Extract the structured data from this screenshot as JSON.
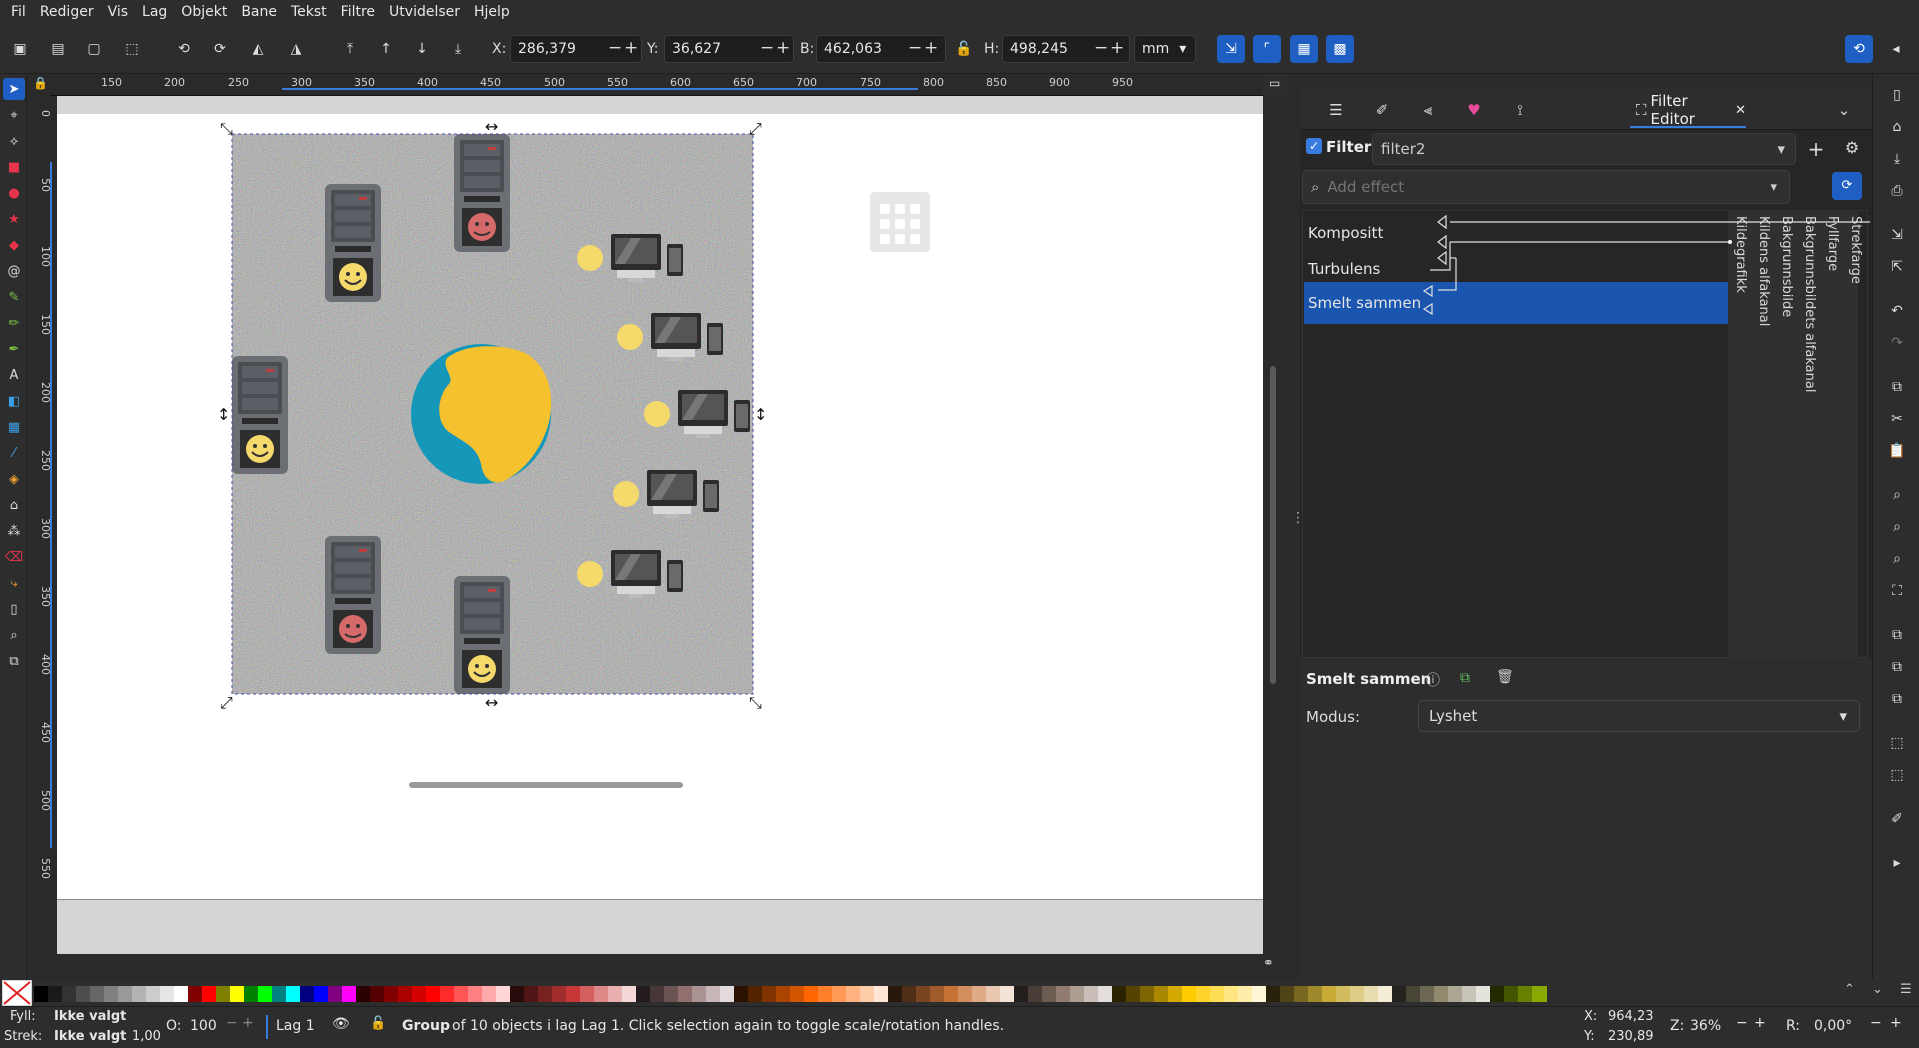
{
  "menu": [
    "Fil",
    "Rediger",
    "Vis",
    "Lag",
    "Objekt",
    "Bane",
    "Tekst",
    "Filtre",
    "Utvidelser",
    "Hjelp"
  ],
  "toolbar": {
    "x_label": "X:",
    "x_value": "286,379",
    "y_label": "Y:",
    "y_value": "36,627",
    "w_label": "B:",
    "w_value": "462,063",
    "h_label": "H:",
    "h_value": "498,245",
    "unit": "mm"
  },
  "ruler_h": [
    "150",
    "200",
    "250",
    "300",
    "350",
    "400",
    "450",
    "500",
    "550",
    "600",
    "650",
    "700",
    "750",
    "800",
    "850",
    "900",
    "950"
  ],
  "ruler_v": [
    "0",
    "50",
    "100",
    "150",
    "200",
    "250",
    "300",
    "350",
    "400",
    "450",
    "500",
    "550"
  ],
  "filter_editor": {
    "tab_title": "Filter Editor",
    "filter_label": "Filter",
    "filter_name": "filter2",
    "add_effect_placeholder": "Add effect",
    "nodes": [
      "Kompositt",
      "Turbulens",
      "Smelt sammen"
    ],
    "inputs": [
      "Kildegrafikk",
      "Kildens alfakanal",
      "Bakgrunnsbilde",
      "Bakgrunnsbildets alfakanal",
      "Fyllfarge",
      "Strekfarge"
    ],
    "selected_effect": "Smelt sammen",
    "mode_label": "Modus:",
    "mode_value": "Lyshet"
  },
  "status": {
    "fill_label": "Fyll:",
    "fill_value": "Ikke valgt",
    "stroke_label": "Strek:",
    "stroke_value": "Ikke valgt",
    "stroke_width": "1,00",
    "opacity_label": "O:",
    "opacity_value": "100",
    "layer": "Lag 1",
    "message_bold": "Group",
    "message": "of 10 objects i lag Lag 1. Click selection again to toggle scale/rotation handles.",
    "x_label": "X:",
    "x_value": "964,23",
    "y_label": "Y:",
    "y_value": "230,89",
    "zoom_label": "Z:",
    "zoom_value": "36%",
    "rot_label": "R:",
    "rot_value": "0,00°"
  },
  "colors": {
    "accent": "#1f5fc4",
    "selected_node": "#1a55b0",
    "globe_ocean": "#1497b8",
    "globe_land": "#f5c12f"
  }
}
